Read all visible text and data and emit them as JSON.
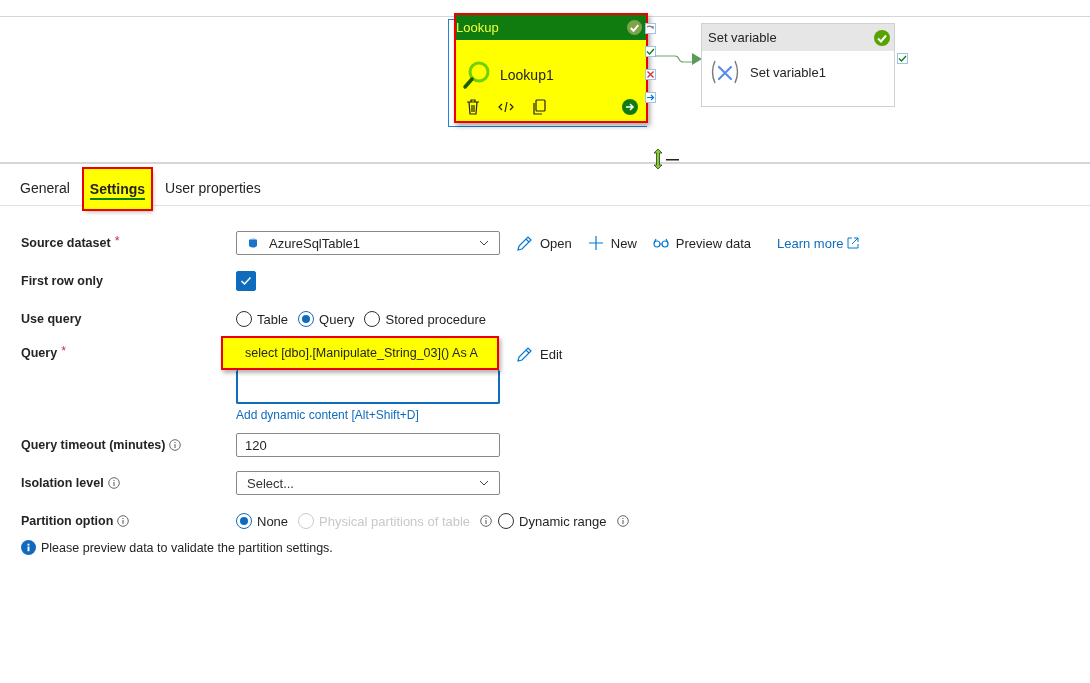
{
  "activities": [
    {
      "kind": "lookup",
      "type_label": "Lookup",
      "name": "Lookup1",
      "highlighted": true
    },
    {
      "kind": "set_variable",
      "type_label": "Set variable",
      "name": "Set variable1",
      "highlighted": false
    }
  ],
  "tabs": [
    {
      "label": "General",
      "selected": false,
      "highlighted": false
    },
    {
      "label": "Settings",
      "selected": true,
      "highlighted": true
    },
    {
      "label": "User properties",
      "selected": false,
      "highlighted": false
    }
  ],
  "source_dataset": {
    "label": "Source dataset",
    "required_mark": "*",
    "value": "AzureSqlTable1",
    "actions": [
      {
        "kind": "edit",
        "label": "Open"
      },
      {
        "kind": "add",
        "label": "New"
      },
      {
        "kind": "preview",
        "label": "Preview data"
      }
    ],
    "link": "Learn more"
  },
  "first_row_only": {
    "label": "First row only",
    "checked": true
  },
  "use_query": {
    "label": "Use query",
    "options": [
      {
        "label": "Table",
        "selected": false,
        "disabled": false,
        "info": false
      },
      {
        "label": "Query",
        "selected": true,
        "disabled": false,
        "info": false
      },
      {
        "label": "Stored procedure",
        "selected": false,
        "disabled": false,
        "info": false
      }
    ]
  },
  "query": {
    "label": "Query",
    "required_mark": "*",
    "value": "select [dbo].[Manipulate_String_03]() As A",
    "highlighted": true,
    "action": "Edit",
    "link": "Add dynamic content [Alt+Shift+D]"
  },
  "query_timeout": {
    "label": "Query timeout (minutes)",
    "info": true,
    "value": "120"
  },
  "isolation_level": {
    "label": "Isolation level",
    "info": true,
    "placeholder": "Select..."
  },
  "partition_option": {
    "label": "Partition option",
    "info": true,
    "options": [
      {
        "label": "None",
        "selected": true,
        "disabled": false,
        "info": false
      },
      {
        "label": "Physical partitions of table",
        "selected": false,
        "disabled": true,
        "info": true
      },
      {
        "label": "Dynamic range",
        "selected": false,
        "disabled": false,
        "info": true
      }
    ]
  },
  "message": "Please preview data to validate the partition settings."
}
